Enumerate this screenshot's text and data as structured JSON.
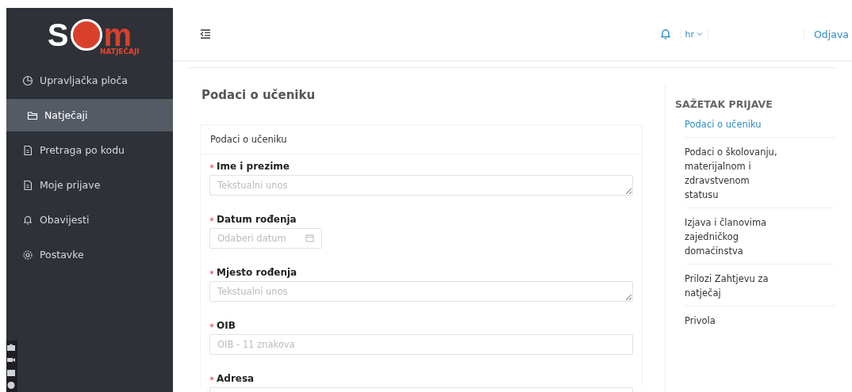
{
  "logo": {
    "left": "S",
    "right": "m",
    "subtitle": "NATJEČAJI"
  },
  "sidebar": {
    "items": [
      {
        "label": "Upravljačka ploča",
        "selected": false
      },
      {
        "label": "Natječaji",
        "selected": true
      },
      {
        "label": "Pretraga po kodu",
        "selected": false
      },
      {
        "label": "Moje prijave",
        "selected": false
      },
      {
        "label": "Obavijesti",
        "selected": false
      },
      {
        "label": "Postavke",
        "selected": false
      }
    ]
  },
  "header": {
    "language": "hr",
    "logout": "Odjava"
  },
  "page_title": "Podaci o učeniku",
  "form": {
    "title": "Podaci o učeniku",
    "fields": [
      {
        "label": "Ime i prezime",
        "required": true,
        "kind": "textarea",
        "placeholder": "Tekstualni unos"
      },
      {
        "label": "Datum rođenja",
        "required": true,
        "kind": "date",
        "placeholder": "Odaberi datum"
      },
      {
        "label": "Mjesto rođenja",
        "required": true,
        "kind": "textarea",
        "placeholder": "Tekstualni unos"
      },
      {
        "label": "OIB",
        "required": true,
        "kind": "text",
        "placeholder": "OIB - 11 znakova"
      },
      {
        "label": "Adresa",
        "required": true,
        "kind": "text"
      }
    ]
  },
  "summary": {
    "title": "SAŽETAK PRIJAVE",
    "items": [
      {
        "label": "Podaci o učeniku",
        "selected": true
      },
      {
        "label": "Podaci o školovanju, materijalnom i zdravstvenom statusu",
        "selected": false
      },
      {
        "label": "Izjava i članovima zajedničkog domaćinstva",
        "selected": false
      },
      {
        "label": "Prilozi Zahtjevu za natječaj",
        "selected": false
      },
      {
        "label": "Privola",
        "selected": false
      }
    ]
  }
}
